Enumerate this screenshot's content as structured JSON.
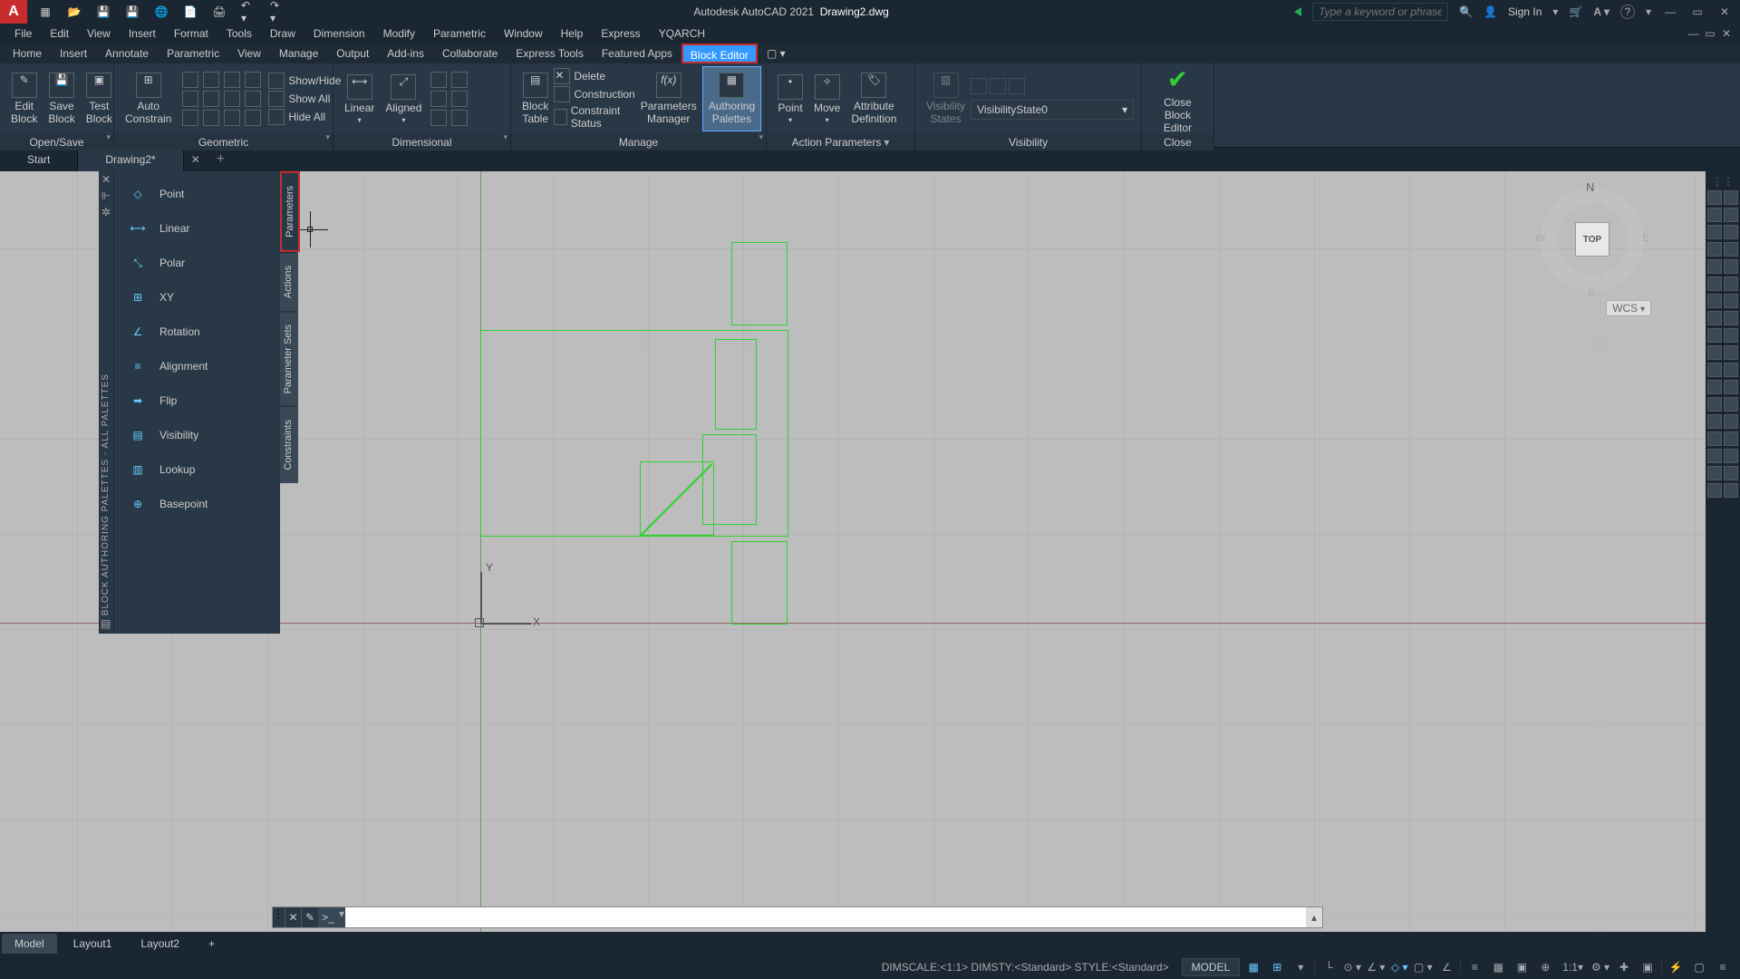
{
  "title": {
    "app": "Autodesk AutoCAD 2021",
    "doc": "Drawing2.dwg"
  },
  "titlebar": {
    "search_placeholder": "Type a keyword or phrase",
    "signin": "Sign In"
  },
  "menubar": [
    "File",
    "Edit",
    "View",
    "Insert",
    "Format",
    "Tools",
    "Draw",
    "Dimension",
    "Modify",
    "Parametric",
    "Window",
    "Help",
    "Express",
    "YQARCH"
  ],
  "ribbon_tabs": [
    "Home",
    "Insert",
    "Annotate",
    "Parametric",
    "View",
    "Manage",
    "Output",
    "Add-ins",
    "Collaborate",
    "Express Tools",
    "Featured Apps",
    "Block Editor"
  ],
  "ribbon_active": "Block Editor",
  "ribbon": {
    "open_save": {
      "title": "Open/Save",
      "edit": "Edit\nBlock",
      "save": "Save\nBlock",
      "test": "Test\nBlock"
    },
    "geometric": {
      "title": "Geometric",
      "auto": "Auto\nConstrain",
      "show_hide": "Show/Hide",
      "show_all": "Show All",
      "hide_all": "Hide All"
    },
    "dimensional": {
      "title": "Dimensional",
      "linear": "Linear",
      "aligned": "Aligned"
    },
    "manage": {
      "title": "Manage",
      "block_table": "Block\nTable",
      "delete": "Delete",
      "construction": "Construction",
      "constraint_status": "Constraint Status",
      "params_mgr": "Parameters\nManager",
      "auth_pal": "Authoring\nPalettes"
    },
    "action_params": {
      "title": "Action Parameters",
      "point": "Point",
      "move": "Move",
      "attr_def": "Attribute\nDefinition"
    },
    "visibility": {
      "title": "Visibility",
      "vis": "Visibility\nStates",
      "combo": "VisibilityState0"
    },
    "close": {
      "title": "Close",
      "close": "Close\nBlock Editor"
    }
  },
  "doc_tabs": {
    "start": "Start",
    "drawing": "Drawing2*"
  },
  "palette": {
    "title": "BLOCK AUTHORING PALETTES - ALL PALETTES",
    "items": [
      "Point",
      "Linear",
      "Polar",
      "XY",
      "Rotation",
      "Alignment",
      "Flip",
      "Visibility",
      "Lookup",
      "Basepoint"
    ],
    "tabs": [
      "Parameters",
      "Actions",
      "Parameter Sets",
      "Constraints"
    ]
  },
  "viewcube": {
    "top": "TOP",
    "n": "N",
    "s": "S",
    "e": "E",
    "w": "W",
    "wcs": "WCS"
  },
  "ucs": {
    "x": "X",
    "y": "Y"
  },
  "layout_tabs": [
    "Model",
    "Layout1",
    "Layout2"
  ],
  "statusbar": {
    "text": "DIMSCALE:<1:1> DIMSTY:<Standard> STYLE:<Standard>",
    "model": "MODEL",
    "scale": "1:1"
  },
  "cmdline": {
    "prompt": ">_"
  }
}
